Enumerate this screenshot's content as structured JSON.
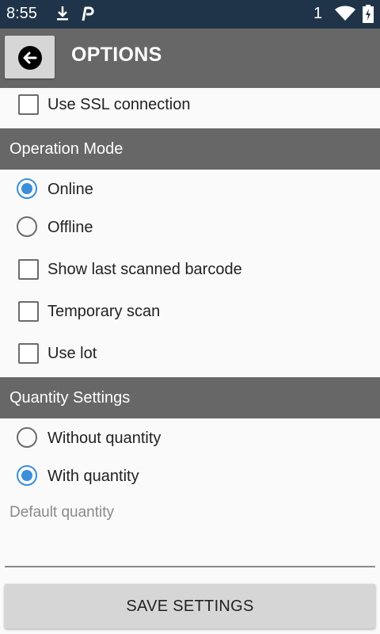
{
  "status_bar": {
    "time": "8:55",
    "notification_count": "1",
    "icons": [
      "download-icon",
      "parking-app-icon",
      "wifi-icon",
      "battery-charging-icon"
    ]
  },
  "app_bar": {
    "title": "OPTIONS",
    "back_icon": "arrow-left-icon"
  },
  "ssl": {
    "label": "Use SSL connection",
    "checked": false
  },
  "operation_mode": {
    "header": "Operation Mode",
    "online": {
      "label": "Online",
      "selected": true
    },
    "offline": {
      "label": "Offline",
      "selected": false
    },
    "show_last_barcode": {
      "label": "Show last scanned barcode",
      "checked": false
    },
    "temporary_scan": {
      "label": "Temporary scan",
      "checked": false
    },
    "use_lot": {
      "label": "Use lot",
      "checked": false
    }
  },
  "quantity_settings": {
    "header": "Quantity Settings",
    "without_quantity": {
      "label": "Without quantity",
      "selected": false
    },
    "with_quantity": {
      "label": "With quantity",
      "selected": true
    },
    "default_quantity": {
      "placeholder": "Default quantity",
      "value": ""
    }
  },
  "save_button": {
    "label": "SAVE SETTINGS"
  },
  "colors": {
    "status_bar": "#1f3448",
    "header": "#676767",
    "accent": "#3b8fd8",
    "button": "#d6d6d6",
    "background": "#fafafa"
  }
}
